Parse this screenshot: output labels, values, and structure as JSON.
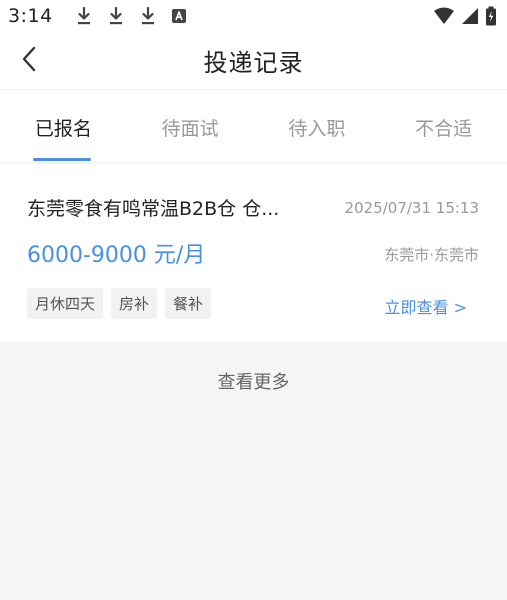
{
  "status_bar": {
    "time": "3:14",
    "icons": [
      "download-icon",
      "download-icon",
      "download-icon",
      "a-icon",
      "wifi-icon",
      "signal-icon",
      "battery-icon"
    ]
  },
  "header": {
    "title": "投递记录"
  },
  "tabs": [
    {
      "label": "已报名",
      "active": true
    },
    {
      "label": "待面试",
      "active": false
    },
    {
      "label": "待入职",
      "active": false
    },
    {
      "label": "不合适",
      "active": false
    }
  ],
  "job": {
    "title": "东莞零食有鸣常温B2B仓 仓...",
    "date": "2025/07/31 15:13",
    "salary": "6000-9000 元/月",
    "location": "东莞市·东莞市",
    "tags": [
      "月休四天",
      "房补",
      "餐补"
    ],
    "action": "立即查看 >"
  },
  "footer": {
    "view_more": "查看更多"
  },
  "colors": {
    "accent": "#4a90e2",
    "muted": "#999999",
    "background": "#f5f5f5"
  }
}
